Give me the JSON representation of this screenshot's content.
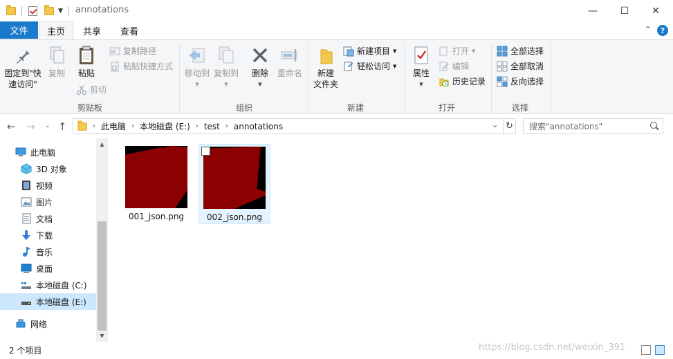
{
  "window": {
    "title": "annotations",
    "minimize": "—",
    "maximize": "☐",
    "close": "✕"
  },
  "tabs": {
    "file": "文件",
    "home": "主页",
    "share": "共享",
    "view": "查看",
    "collapse": "^",
    "help": "?"
  },
  "ribbon": {
    "clipboard": {
      "label": "剪贴板",
      "pin": "固定到\"快\n速访问\"",
      "copy": "复制",
      "paste": "粘贴",
      "copy_path": "复制路径",
      "paste_shortcut": "粘贴快捷方式",
      "cut": "剪切"
    },
    "organize": {
      "label": "组织",
      "move_to": "移动到",
      "copy_to": "复制到",
      "delete": "删除",
      "rename": "重命名"
    },
    "new": {
      "label": "新建",
      "new_folder": "新建\n文件夹",
      "new_item": "新建项目",
      "easy_access": "轻松访问"
    },
    "open": {
      "label": "打开",
      "properties": "属性",
      "open": "打开",
      "edit": "编辑",
      "history": "历史记录"
    },
    "select": {
      "label": "选择",
      "select_all": "全部选择",
      "select_none": "全部取消",
      "invert": "反向选择"
    }
  },
  "address": {
    "crumbs": [
      "此电脑",
      "本地磁盘 (E:)",
      "test",
      "annotations"
    ],
    "search_placeholder": "搜索\"annotations\""
  },
  "navpane": {
    "items": [
      {
        "label": "此电脑",
        "icon": "pc-icon"
      },
      {
        "label": "3D 对象",
        "icon": "3d-objects-icon"
      },
      {
        "label": "视频",
        "icon": "video-icon"
      },
      {
        "label": "图片",
        "icon": "pictures-icon"
      },
      {
        "label": "文档",
        "icon": "documents-icon"
      },
      {
        "label": "下载",
        "icon": "download-icon"
      },
      {
        "label": "音乐",
        "icon": "music-icon"
      },
      {
        "label": "桌面",
        "icon": "desktop-icon"
      },
      {
        "label": "本地磁盘 (C:)",
        "icon": "drive-c-icon"
      },
      {
        "label": "本地磁盘 (E:)",
        "icon": "drive-e-icon",
        "selected": true
      },
      {
        "label": "网络",
        "icon": "network-icon"
      }
    ]
  },
  "files": [
    {
      "name": "001_json.png"
    },
    {
      "name": "002_json.png"
    }
  ],
  "status": {
    "count": "2 个项目",
    "watermark": "https://blog.csdn.net/weixin_391"
  },
  "colors": {
    "accent": "#1979ca",
    "selection": "#cce8ff",
    "thumb_red": "#8b0000"
  }
}
